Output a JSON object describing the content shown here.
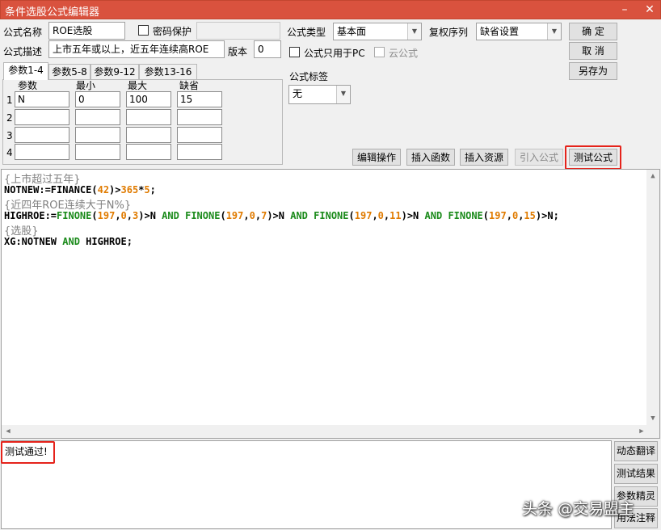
{
  "window": {
    "title": "条件选股公式编辑器",
    "minimize_glyph": "–",
    "close_glyph": "✕"
  },
  "form": {
    "name_label": "公式名称",
    "name_value": "ROE选股",
    "password_label": "密码保护",
    "desc_label": "公式描述",
    "desc_value": "上市五年或以上，近五年连续高ROE",
    "version_label": "版本",
    "version_value": "0",
    "type_label": "公式类型",
    "type_value": "基本面",
    "rights_label": "复权序列",
    "rights_value": "缺省设置",
    "pc_only_label": "公式只用于PC",
    "cloud_label": "云公式",
    "tag_label": "公式标签",
    "tag_value": "无"
  },
  "buttons": {
    "ok": "确  定",
    "cancel": "取  消",
    "save_as": "另存为",
    "edit_ops": "编辑操作",
    "insert_func": "插入函数",
    "insert_res": "插入资源",
    "import_formula": "引入公式",
    "test_formula": "测试公式"
  },
  "param_tabs": [
    "参数1-4",
    "参数5-8",
    "参数9-12",
    "参数13-16"
  ],
  "param_table": {
    "headers": [
      "参数",
      "最小",
      "最大",
      "缺省"
    ],
    "rows": [
      {
        "index": "1",
        "name": "N",
        "min": "0",
        "max": "100",
        "default": "15"
      },
      {
        "index": "2",
        "name": "",
        "min": "",
        "max": "",
        "default": ""
      },
      {
        "index": "3",
        "name": "",
        "min": "",
        "max": "",
        "default": ""
      },
      {
        "index": "4",
        "name": "",
        "min": "",
        "max": "",
        "default": ""
      }
    ]
  },
  "code": {
    "c1": "{上市超过五年}",
    "l2a": "NOTNEW:=FINANCE(",
    "l2n1": "42",
    "l2b": ")>",
    "l2n2": "365",
    "l2c": "*",
    "l2n3": "5",
    "l2d": ";",
    "c3": "{近四年ROE连续大于N%}",
    "l4a": "HIGHROE:=",
    "l4kw": "FINONE",
    "l4args1": "197",
    "l4args1b": "0",
    "l4args1c": "3",
    "l4and": "AND",
    "l4args2c": "7",
    "l4args3c": "11",
    "l4args4c": "15",
    "l4n": "N",
    "c5": "{选股}",
    "l6a": "XG:NOTNEW ",
    "l6b": " HIGHROE;"
  },
  "output": {
    "message": "测试通过!"
  },
  "side_buttons": [
    "动态翻译",
    "测试结果",
    "参数精灵",
    "用法注释"
  ],
  "watermark": "头条 @交易盟主",
  "colors": {
    "titlebar": "#d9523e",
    "keyword": "#1a8a1a",
    "number": "#e07b00",
    "comment": "#808080",
    "highlight": "#e5231b"
  }
}
